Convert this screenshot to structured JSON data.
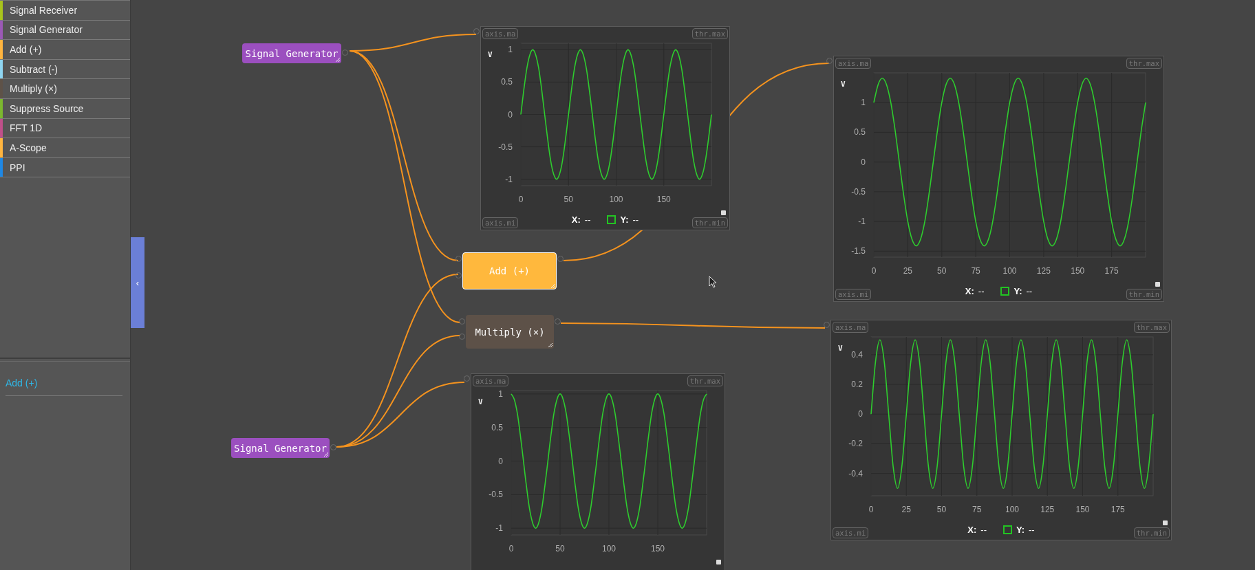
{
  "sidebar": {
    "items": [
      {
        "label": "Signal Receiver",
        "color": "#a9c41c"
      },
      {
        "label": "Signal Generator",
        "color": "#9b59b6"
      },
      {
        "label": "Add (+)",
        "color": "#ffb53f"
      },
      {
        "label": "Subtract (-)",
        "color": "#8fd6f2"
      },
      {
        "label": "Multiply (×)",
        "color": "#5e5248"
      },
      {
        "label": "Suppress Source",
        "color": "#7cb82f"
      },
      {
        "label": "FFT 1D",
        "color": "#c0508a"
      },
      {
        "label": "A-Scope",
        "color": "#ffb53f"
      },
      {
        "label": "PPI",
        "color": "#1e88e5"
      }
    ],
    "collapse_handle": "‹",
    "inspector": {
      "title": "Add (+)"
    }
  },
  "canvas": {
    "nodes": [
      {
        "kind": "generator",
        "label": "Signal Generator",
        "color": "#9b4fbf",
        "selected": false
      },
      {
        "kind": "operator",
        "label": "Add (+)",
        "color": "#ffb83d",
        "selected": true
      },
      {
        "kind": "operator",
        "label": "Multiply (×)",
        "color": "#5d5148",
        "selected": false
      },
      {
        "kind": "generator",
        "label": "Signal Generator",
        "color": "#9b4fbf",
        "selected": false
      }
    ],
    "scopes": [
      {
        "corner_labels": {
          "top_left": "axis.ma",
          "top_right": "thr.max",
          "bottom_left": "axis.mi",
          "bottom_right": "thr.min"
        },
        "unit": "V",
        "legend": {
          "x_label": "X:",
          "x_value": "--",
          "y_label": "Y:",
          "y_value": "--"
        },
        "chart_data": {
          "type": "line",
          "grid": true,
          "xlim": [
            0,
            200
          ],
          "ylim": [
            -1.1,
            1.1
          ],
          "xticks": [
            0,
            50,
            100,
            150
          ],
          "yticks": [
            -1,
            -0.5,
            0,
            0.5,
            1
          ],
          "x": [
            0,
            3.125,
            6.25,
            9.375,
            12.5,
            15.625,
            18.75,
            21.875,
            25,
            28.125,
            31.25,
            34.375,
            37.5,
            40.625,
            43.75,
            46.875,
            50,
            53.125,
            56.25,
            59.375,
            62.5,
            65.625,
            68.75,
            71.875,
            75,
            78.125,
            81.25,
            84.375,
            87.5,
            90.625,
            93.75,
            96.875,
            100,
            103.125,
            106.25,
            109.375,
            112.5,
            115.625,
            118.75,
            121.875,
            125,
            128.125,
            131.25,
            134.375,
            137.5,
            140.625,
            143.75,
            146.875,
            150,
            153.125,
            156.25,
            159.375,
            162.5,
            165.625,
            168.75,
            171.875,
            175,
            178.125,
            181.25,
            184.375,
            187.5,
            190.625,
            193.75,
            196.875,
            200
          ],
          "series": [
            {
              "color": "#2ecc2e",
              "values": [
                0,
                0.38,
                0.71,
                0.92,
                1,
                0.92,
                0.71,
                0.38,
                0,
                -0.38,
                -0.71,
                -0.92,
                -1,
                -0.92,
                -0.71,
                -0.38,
                0,
                0.38,
                0.71,
                0.92,
                1,
                0.92,
                0.71,
                0.38,
                0,
                -0.38,
                -0.71,
                -0.92,
                -1,
                -0.92,
                -0.71,
                -0.38,
                0,
                0.38,
                0.71,
                0.92,
                1,
                0.92,
                0.71,
                0.38,
                0,
                -0.38,
                -0.71,
                -0.92,
                -1,
                -0.92,
                -0.71,
                -0.38,
                0,
                0.38,
                0.71,
                0.92,
                1,
                0.92,
                0.71,
                0.38,
                0,
                -0.38,
                -0.71,
                -0.92,
                -1,
                -0.92,
                -0.71,
                -0.38,
                0
              ]
            }
          ]
        }
      },
      {
        "corner_labels": {
          "top_left": "axis.ma",
          "top_right": "thr.max",
          "bottom_left": "axis.mi",
          "bottom_right": "thr.min"
        },
        "unit": "V",
        "legend": {
          "x_label": "X:",
          "x_value": "--",
          "y_label": "Y:",
          "y_value": "--"
        },
        "chart_data": {
          "type": "line",
          "grid": true,
          "xticks": [
            0,
            25,
            50,
            75,
            100,
            125,
            150,
            175
          ],
          "yticks": [
            -1.5,
            -1,
            -0.5,
            0,
            0.5,
            1
          ],
          "xlim": [
            0,
            200
          ],
          "ylim": [
            -1.6,
            1.5
          ],
          "x": [
            0,
            3.125,
            6.25,
            9.375,
            12.5,
            15.625,
            18.75,
            21.875,
            25,
            28.125,
            31.25,
            34.375,
            37.5,
            40.625,
            43.75,
            46.875,
            50,
            53.125,
            56.25,
            59.375,
            62.5,
            65.625,
            68.75,
            71.875,
            75,
            78.125,
            81.25,
            84.375,
            87.5,
            90.625,
            93.75,
            96.875,
            100,
            103.125,
            106.25,
            109.375,
            112.5,
            115.625,
            118.75,
            121.875,
            125,
            128.125,
            131.25,
            134.375,
            137.5,
            140.625,
            143.75,
            146.875,
            150,
            153.125,
            156.25,
            159.375,
            162.5,
            165.625,
            168.75,
            171.875,
            175,
            178.125,
            181.25,
            184.375,
            187.5,
            190.625,
            193.75,
            196.875,
            200
          ],
          "series": [
            {
              "color": "#2ecc2e",
              "values": [
                1,
                1.3,
                1.41,
                1.3,
                1,
                0.54,
                0,
                -0.54,
                -1,
                -1.3,
                -1.41,
                -1.3,
                -1,
                -0.54,
                0,
                0.54,
                1,
                1.3,
                1.41,
                1.3,
                1,
                0.54,
                0,
                -0.54,
                -1,
                -1.3,
                -1.41,
                -1.3,
                -1,
                -0.54,
                0,
                0.54,
                1,
                1.3,
                1.41,
                1.3,
                1,
                0.54,
                0,
                -0.54,
                -1,
                -1.3,
                -1.41,
                -1.3,
                -1,
                -0.54,
                0,
                0.54,
                1,
                1.3,
                1.41,
                1.3,
                1,
                0.54,
                0,
                -0.54,
                -1,
                -1.3,
                -1.41,
                -1.3,
                -1,
                -0.54,
                0,
                0.54,
                1
              ]
            }
          ]
        }
      },
      {
        "corner_labels": {
          "top_left": "axis.ma",
          "top_right": "thr.max",
          "bottom_left": "axis.mi",
          "bottom_right": "thr.min"
        },
        "unit": "V",
        "legend": {
          "x_label": "X:",
          "x_value": "--",
          "y_label": "Y:",
          "y_value": "--"
        },
        "chart_data": {
          "type": "line",
          "grid": true,
          "xticks": [
            0,
            25,
            50,
            75,
            100,
            125,
            150,
            175
          ],
          "yticks": [
            -0.4,
            -0.2,
            0,
            0.2,
            0.4
          ],
          "xlim": [
            0,
            200
          ],
          "ylim": [
            -0.55,
            0.52
          ],
          "x": [
            0,
            3.125,
            6.25,
            9.375,
            12.5,
            15.625,
            18.75,
            21.875,
            25,
            28.125,
            31.25,
            34.375,
            37.5,
            40.625,
            43.75,
            46.875,
            50,
            53.125,
            56.25,
            59.375,
            62.5,
            65.625,
            68.75,
            71.875,
            75,
            78.125,
            81.25,
            84.375,
            87.5,
            90.625,
            93.75,
            96.875,
            100,
            103.125,
            106.25,
            109.375,
            112.5,
            115.625,
            118.75,
            121.875,
            125,
            128.125,
            131.25,
            134.375,
            137.5,
            140.625,
            143.75,
            146.875,
            150,
            153.125,
            156.25,
            159.375,
            162.5,
            165.625,
            168.75,
            171.875,
            175,
            178.125,
            181.25,
            184.375,
            187.5,
            190.625,
            193.75,
            196.875,
            200
          ],
          "series": [
            {
              "color": "#2ecc2e",
              "values": [
                0,
                0.35,
                0.5,
                0.35,
                0,
                -0.35,
                -0.5,
                -0.35,
                0,
                0.35,
                0.5,
                0.35,
                0,
                -0.35,
                -0.5,
                -0.35,
                0,
                0.35,
                0.5,
                0.35,
                0,
                -0.35,
                -0.5,
                -0.35,
                0,
                0.35,
                0.5,
                0.35,
                0,
                -0.35,
                -0.5,
                -0.35,
                0,
                0.35,
                0.5,
                0.35,
                0,
                -0.35,
                -0.5,
                -0.35,
                0,
                0.35,
                0.5,
                0.35,
                0,
                -0.35,
                -0.5,
                -0.35,
                0,
                0.35,
                0.5,
                0.35,
                0,
                -0.35,
                -0.5,
                -0.35,
                0,
                0.35,
                0.5,
                0.35,
                0,
                -0.35,
                -0.5,
                -0.35,
                0
              ]
            }
          ]
        }
      },
      {
        "corner_labels": {
          "top_left": "axis.ma",
          "top_right": "thr.max"
        },
        "unit": "V",
        "chart_data": {
          "type": "line",
          "xlim": [
            0,
            200
          ],
          "ylim": [
            -1.1,
            1.05
          ],
          "grid": true,
          "xticks": [
            0,
            50,
            100,
            150
          ],
          "yticks": [
            -1,
            -0.5,
            0,
            0.5,
            1
          ],
          "x": [
            0,
            3.125,
            6.25,
            9.375,
            12.5,
            15.625,
            18.75,
            21.875,
            25,
            28.125,
            31.25,
            34.375,
            37.5,
            40.625,
            43.75,
            46.875,
            50,
            53.125,
            56.25,
            59.375,
            62.5,
            65.625,
            68.75,
            71.875,
            75,
            78.125,
            81.25,
            84.375,
            87.5,
            90.625,
            93.75,
            96.875,
            100,
            103.125,
            106.25,
            109.375,
            112.5,
            115.625,
            118.75,
            121.875,
            125,
            128.125,
            131.25,
            134.375,
            137.5,
            140.625,
            143.75,
            146.875,
            150,
            153.125,
            156.25,
            159.375,
            162.5,
            165.625,
            168.75,
            171.875,
            175,
            178.125,
            181.25,
            184.375,
            187.5,
            190.625,
            193.75,
            196.875,
            200
          ],
          "series": [
            {
              "color": "#2ecc2e",
              "values": [
                1,
                0.92,
                0.71,
                0.38,
                0,
                -0.38,
                -0.71,
                -0.92,
                -1,
                -0.92,
                -0.71,
                -0.38,
                0,
                0.38,
                0.71,
                0.92,
                1,
                0.92,
                0.71,
                0.38,
                0,
                -0.38,
                -0.71,
                -0.92,
                -1,
                -0.92,
                -0.71,
                -0.38,
                0,
                0.38,
                0.71,
                0.92,
                1,
                0.92,
                0.71,
                0.38,
                0,
                -0.38,
                -0.71,
                -0.92,
                -1,
                -0.92,
                -0.71,
                -0.38,
                0,
                0.38,
                0.71,
                0.92,
                1,
                0.92,
                0.71,
                0.38,
                0,
                -0.38,
                -0.71,
                -0.92,
                -1,
                -0.92,
                -0.71,
                -0.38,
                0,
                0.38,
                0.71,
                0.92,
                1
              ]
            }
          ]
        }
      }
    ]
  }
}
